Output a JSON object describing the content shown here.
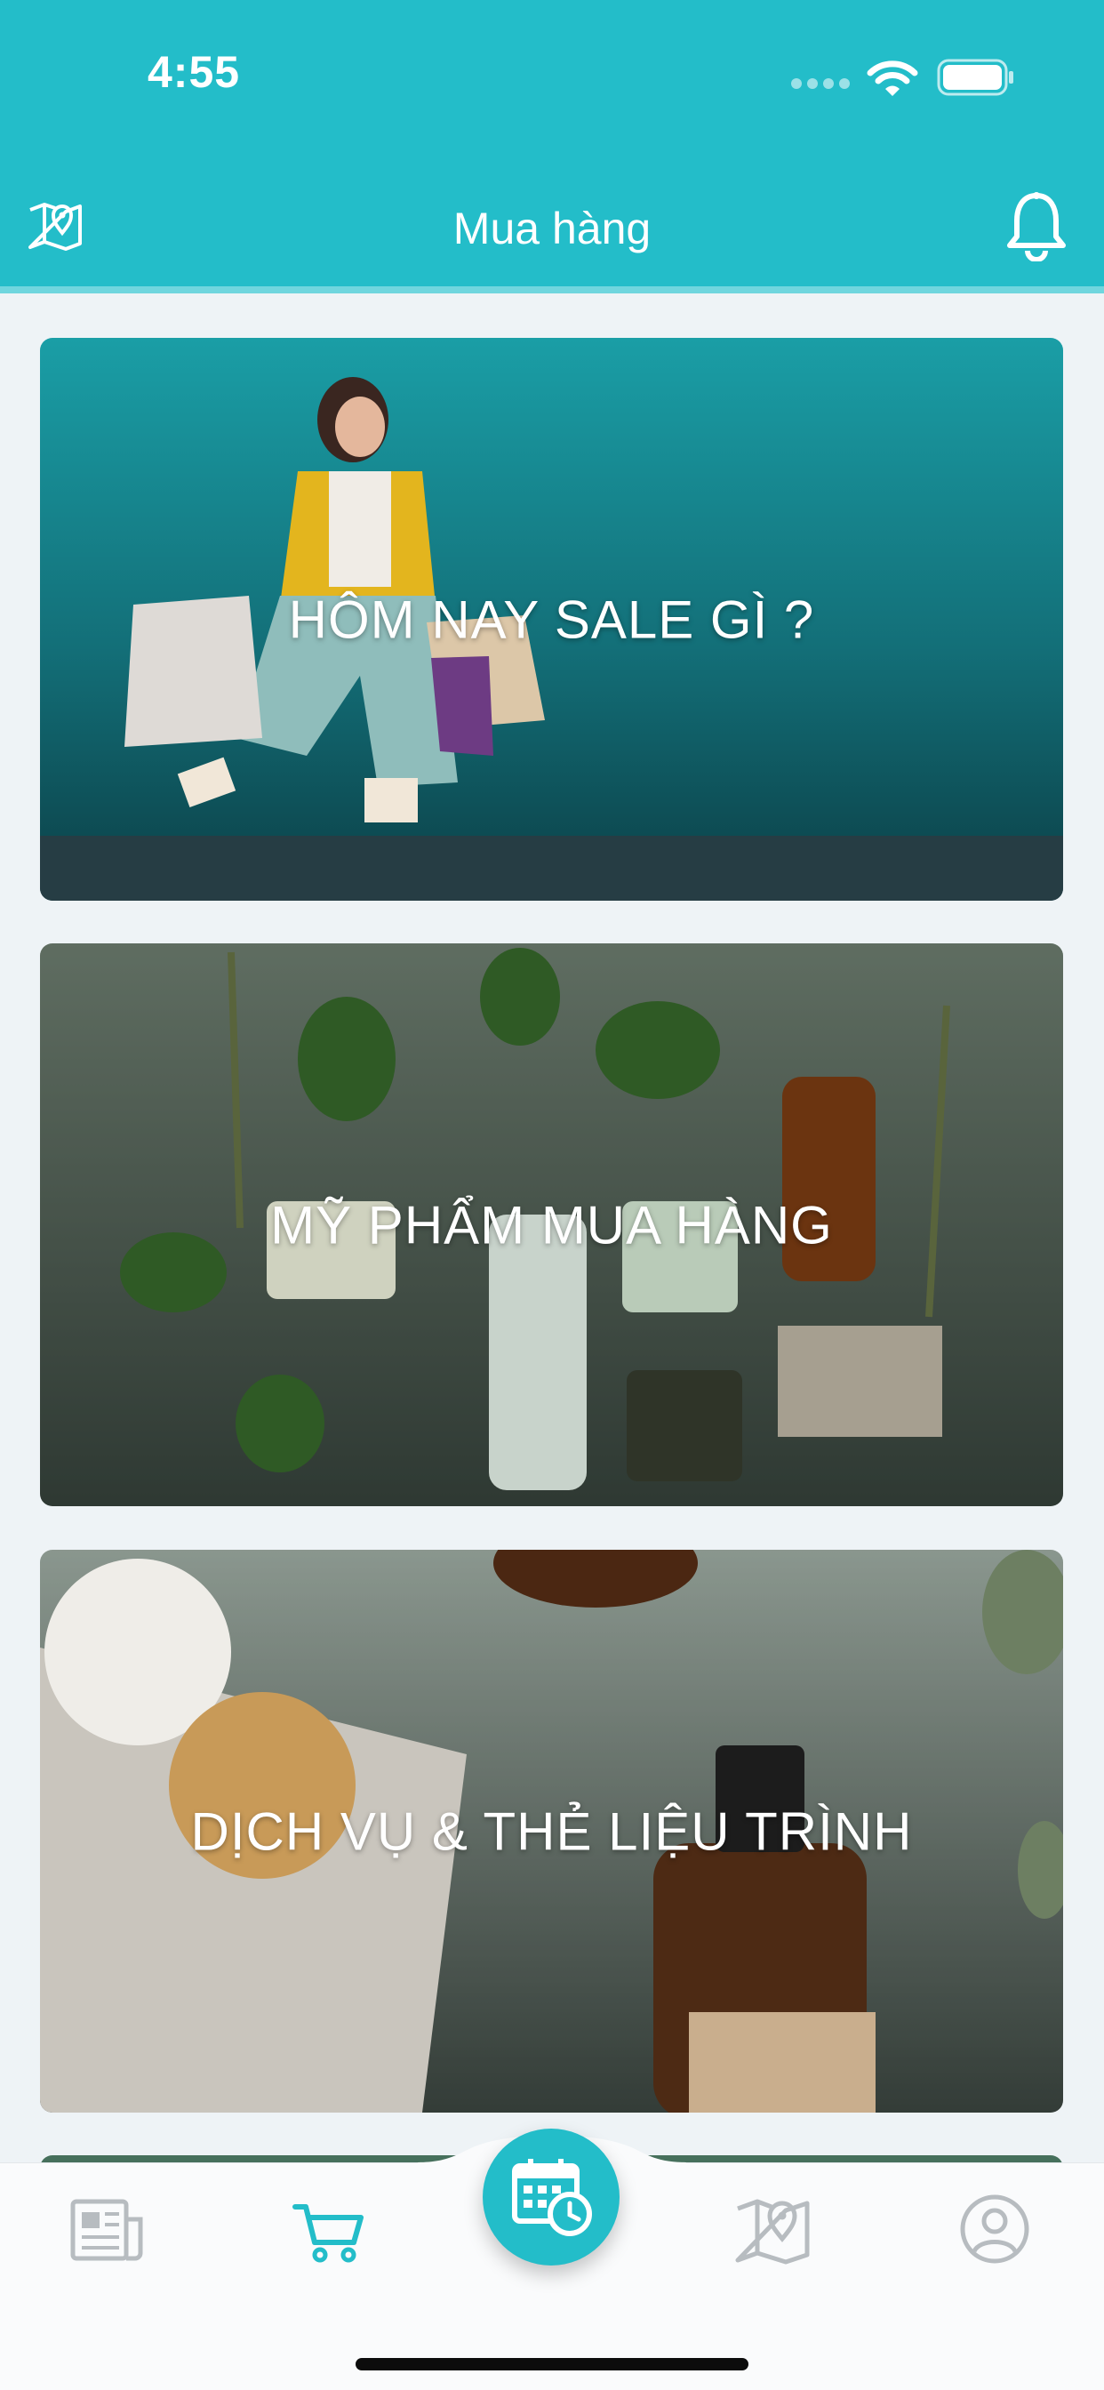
{
  "status_bar": {
    "time": "4:55"
  },
  "nav": {
    "title": "Mua hàng",
    "left_icon": "map-pin-icon",
    "right_icon": "bell-icon"
  },
  "cards": [
    {
      "title": "HÔM NAY SALE GÌ ?",
      "image": "shopping-woman-photo"
    },
    {
      "title": "MỸ PHẨM MUA HÀNG",
      "image": "cosmetics-herbs-photo"
    },
    {
      "title": "DỊCH VỤ & THẺ LIỆU TRÌNH",
      "image": "skincare-bottles-photo"
    }
  ],
  "tabbar": {
    "active_tab": "cart",
    "tabs": [
      {
        "id": "news",
        "icon": "newspaper-icon"
      },
      {
        "id": "cart",
        "icon": "cart-icon"
      },
      {
        "id": "booking",
        "icon": "calendar-clock-icon"
      },
      {
        "id": "map",
        "icon": "map-pin-icon"
      },
      {
        "id": "profile",
        "icon": "user-circle-icon"
      }
    ]
  },
  "colors": {
    "accent": "#23bdc9",
    "background": "#eef3f6",
    "tab_inactive": "#b7bcc0"
  }
}
